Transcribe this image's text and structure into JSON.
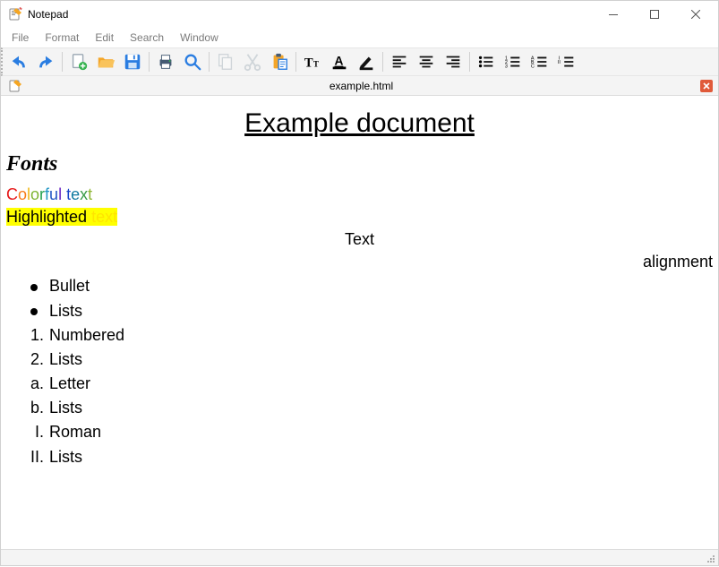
{
  "window": {
    "title": "Notepad"
  },
  "menu": {
    "file": "File",
    "format": "Format",
    "edit": "Edit",
    "search": "Search",
    "window": "Window"
  },
  "tab": {
    "label": "example.html"
  },
  "doc": {
    "title": "Example document",
    "fonts_heading": "Fonts",
    "colorful": {
      "c1": "C",
      "c2": "o",
      "c3": "l",
      "c4": "o",
      "c5": "r",
      "c6": "f",
      "c7": "u",
      "c8": "l",
      "sp": " ",
      "t1": "t",
      "t2": "e",
      "t3": "x",
      "t4": "t"
    },
    "highlighted": {
      "word": "Highlighted ",
      "text": "text"
    },
    "center": "Text",
    "right": "alignment",
    "bullets": {
      "0": "Bullet",
      "1": "Lists"
    },
    "numbered": {
      "m0": "1.",
      "v0": "Numbered",
      "m1": "2.",
      "v1": "Lists"
    },
    "letter": {
      "m0": "a.",
      "v0": "Letter",
      "m1": "b.",
      "v1": "Lists"
    },
    "roman": {
      "m0": "I.",
      "v0": "Roman",
      "m1": "II.",
      "v1": "Lists"
    }
  },
  "colors": {
    "colorful": [
      "#e6191a",
      "#f77c19",
      "#f0b81b",
      "#7eb433",
      "#23a14d",
      "#2396c4",
      "#2356c4",
      "#6a29c4",
      "#000000",
      "#1947c9",
      "#1079a0",
      "#3a9b47",
      "#8fb634"
    ]
  }
}
